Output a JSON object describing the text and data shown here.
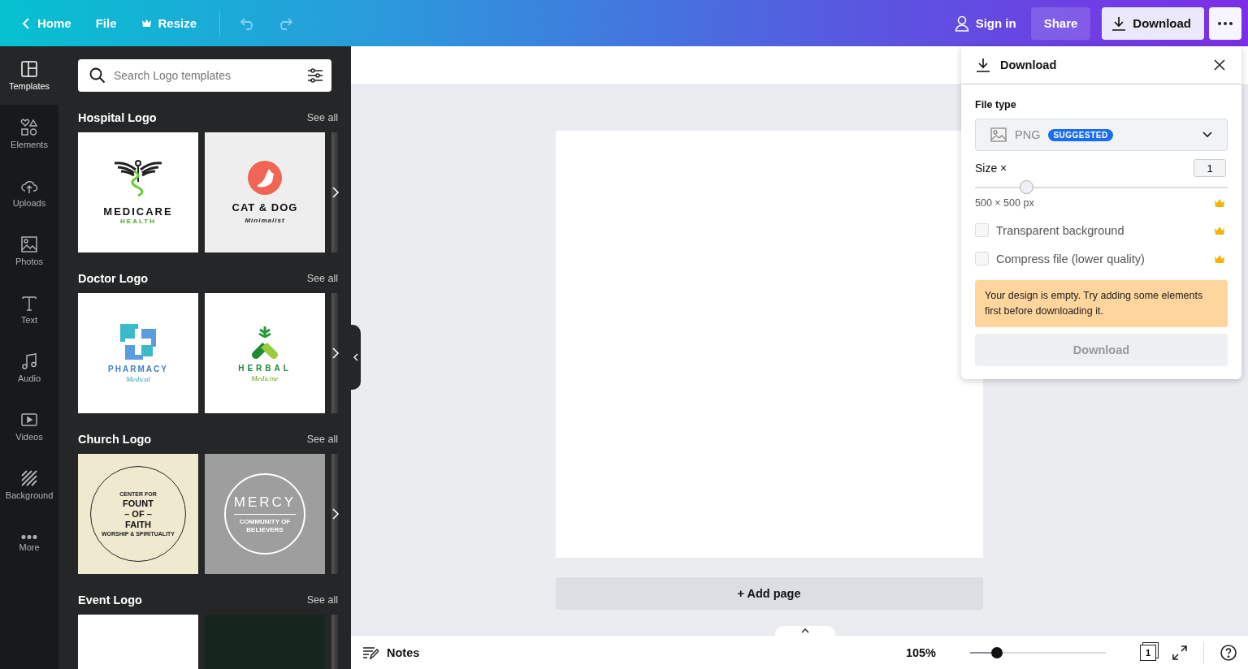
{
  "topbar": {
    "home": "Home",
    "file": "File",
    "resize": "Resize",
    "sign_in": "Sign in",
    "share": "Share",
    "download": "Download"
  },
  "sidebar": {
    "items": [
      {
        "label": "Templates",
        "kind": "templates",
        "selected": true
      },
      {
        "label": "Elements",
        "kind": "elements",
        "selected": false
      },
      {
        "label": "Uploads",
        "kind": "uploads",
        "selected": false
      },
      {
        "label": "Photos",
        "kind": "photos",
        "selected": false
      },
      {
        "label": "Text",
        "kind": "text",
        "selected": false
      },
      {
        "label": "Audio",
        "kind": "audio",
        "selected": false
      },
      {
        "label": "Videos",
        "kind": "videos",
        "selected": false
      },
      {
        "label": "Background",
        "kind": "background",
        "selected": false
      },
      {
        "label": "More",
        "kind": "more",
        "selected": false
      }
    ]
  },
  "search": {
    "placeholder": "Search Logo templates"
  },
  "sections": [
    {
      "title": "Hospital Logo",
      "see_all": "See all",
      "templates": [
        {
          "kind": "medicare",
          "lines": [
            "MEDICARE",
            "HEALTH"
          ]
        },
        {
          "kind": "catdog",
          "lines": [
            "CAT & DOG",
            "Minimalist"
          ]
        }
      ]
    },
    {
      "title": "Doctor Logo",
      "see_all": "See all",
      "templates": [
        {
          "kind": "pharmacy",
          "lines": [
            "PHARMACY",
            "Medical"
          ]
        },
        {
          "kind": "herbal",
          "lines": [
            "HERBAL",
            "Medicine"
          ]
        }
      ]
    },
    {
      "title": "Church Logo",
      "see_all": "See all",
      "templates": [
        {
          "kind": "faith",
          "lines": [
            "CENTER FOR",
            "FOUNT",
            "– OF –",
            "FAITH",
            "WORSHIP & SPIRITUALITY"
          ]
        },
        {
          "kind": "mercy",
          "lines": [
            "MERCY",
            "COMMUNITY OF",
            "BELIEVERS"
          ]
        }
      ]
    },
    {
      "title": "Event Logo",
      "see_all": "See all",
      "templates": [
        {
          "kind": "blank-light"
        },
        {
          "kind": "blank-dark"
        }
      ]
    }
  ],
  "canvas": {
    "add_page": "+ Add page"
  },
  "download_panel": {
    "title": "Download",
    "file_type_label": "File type",
    "file_type": "PNG",
    "badge": "SUGGESTED",
    "size_label": "Size ×",
    "size_value": "1",
    "size_slider": {
      "level": 0.2
    },
    "dimensions": "500 × 500 px",
    "options": [
      {
        "label": "Transparent background",
        "checked": false
      },
      {
        "label": "Compress file (lower quality)",
        "checked": false
      }
    ],
    "warning": "Your design is empty. Try adding some elements first before downloading it.",
    "button": {
      "label": "Download",
      "disabled": true
    }
  },
  "bottom_bar": {
    "notes": "Notes",
    "zoom": "105%",
    "zoom_slider": {
      "level": 0.2
    },
    "page_count": "1"
  }
}
